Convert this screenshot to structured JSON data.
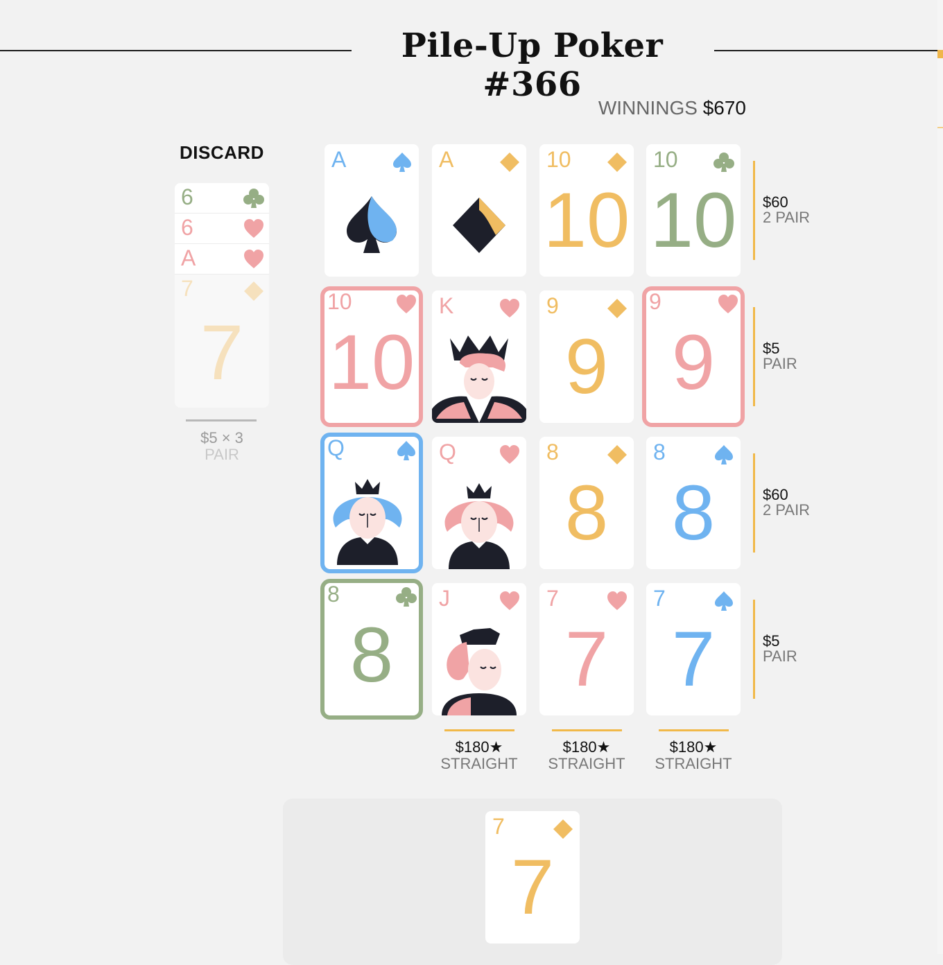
{
  "title": "Pile-Up Poker #366",
  "winnings": {
    "label": "WINNINGS",
    "amount": "$670"
  },
  "discard": {
    "label": "DISCARD",
    "pile": [
      {
        "rank": "6",
        "suit": "club",
        "color": "green"
      },
      {
        "rank": "6",
        "suit": "heart",
        "color": "pink"
      },
      {
        "rank": "A",
        "suit": "heart",
        "color": "pink"
      }
    ],
    "top_card": {
      "rank": "7",
      "suit": "diamond",
      "color": "gold"
    },
    "score": "$5 × 3",
    "hand": "PAIR"
  },
  "grid": [
    [
      {
        "rank": "A",
        "suit": "spade",
        "color": "blue",
        "face": "ace-spade"
      },
      {
        "rank": "A",
        "suit": "diamond",
        "color": "gold",
        "face": "ace-diamond"
      },
      {
        "rank": "10",
        "suit": "diamond",
        "color": "gold",
        "big": "10"
      },
      {
        "rank": "10",
        "suit": "club",
        "color": "green",
        "big": "10"
      }
    ],
    [
      {
        "rank": "10",
        "suit": "heart",
        "color": "pink",
        "big": "10",
        "highlight": "pink"
      },
      {
        "rank": "K",
        "suit": "heart",
        "color": "pink",
        "face": "king"
      },
      {
        "rank": "9",
        "suit": "diamond",
        "color": "gold",
        "big": "9"
      },
      {
        "rank": "9",
        "suit": "heart",
        "color": "pink",
        "big": "9",
        "highlight": "pink"
      }
    ],
    [
      {
        "rank": "Q",
        "suit": "spade",
        "color": "blue",
        "face": "queen",
        "highlight": "blue"
      },
      {
        "rank": "Q",
        "suit": "heart",
        "color": "pink",
        "face": "queen"
      },
      {
        "rank": "8",
        "suit": "diamond",
        "color": "gold",
        "big": "8"
      },
      {
        "rank": "8",
        "suit": "spade",
        "color": "blue",
        "big": "8"
      }
    ],
    [
      {
        "rank": "8",
        "suit": "club",
        "color": "green",
        "big": "8",
        "highlight": "green"
      },
      {
        "rank": "J",
        "suit": "heart",
        "color": "pink",
        "face": "jack"
      },
      {
        "rank": "7",
        "suit": "heart",
        "color": "pink",
        "big": "7"
      },
      {
        "rank": "7",
        "suit": "spade",
        "color": "blue",
        "big": "7"
      }
    ]
  ],
  "row_scores": [
    {
      "amount": "$60",
      "hand": "2 PAIR"
    },
    {
      "amount": "$5",
      "hand": "PAIR"
    },
    {
      "amount": "$60",
      "hand": "2 PAIR"
    },
    {
      "amount": "$5",
      "hand": "PAIR"
    }
  ],
  "col_scores": [
    null,
    {
      "amount": "$180★",
      "hand": "STRAIGHT"
    },
    {
      "amount": "$180★",
      "hand": "STRAIGHT"
    },
    {
      "amount": "$180★",
      "hand": "STRAIGHT"
    }
  ],
  "next_card": {
    "rank": "7",
    "suit": "diamond",
    "color": "gold",
    "big": "7"
  },
  "colors": {
    "blue": "#6fb3f0",
    "pink": "#f0a3a5",
    "gold": "#f0bd62",
    "green": "#96ae85",
    "dark": "#1d1f2a"
  }
}
